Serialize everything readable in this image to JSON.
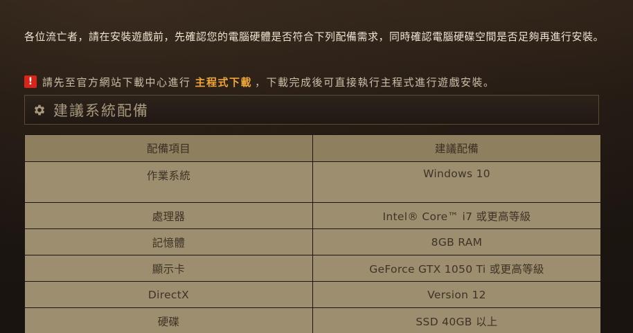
{
  "intro": {
    "text": "各位流亡者，請在安裝遊戲前，先確認您的電腦硬體是否符合下列配備需求，同時確認電腦硬碟空間是否足夠再進行安裝。"
  },
  "notice": {
    "icon": "exclamation-icon",
    "prefix": "請先至官方網站下載中心進行",
    "link": "主程式下載",
    "suffix": "，下載完成後可直接執行主程式進行遊戲安裝。",
    "icon_color": "#d9241a",
    "link_color": "#f0a637"
  },
  "section": {
    "icon": "gear-icon",
    "title": "建議系統配備"
  },
  "table": {
    "headers": [
      "配備項目",
      "建議配備"
    ],
    "rows": [
      [
        "作業系統",
        "Windows 10"
      ],
      [
        "處理器",
        "Intel® Core™ i7 或更高等級"
      ],
      [
        "記憶體",
        "8GB RAM"
      ],
      [
        "顯示卡",
        "GeForce GTX 1050 Ti 或更高等級"
      ],
      [
        "DirectX",
        "Version 12"
      ],
      [
        "硬碟",
        "SSD 40GB 以上"
      ]
    ]
  }
}
